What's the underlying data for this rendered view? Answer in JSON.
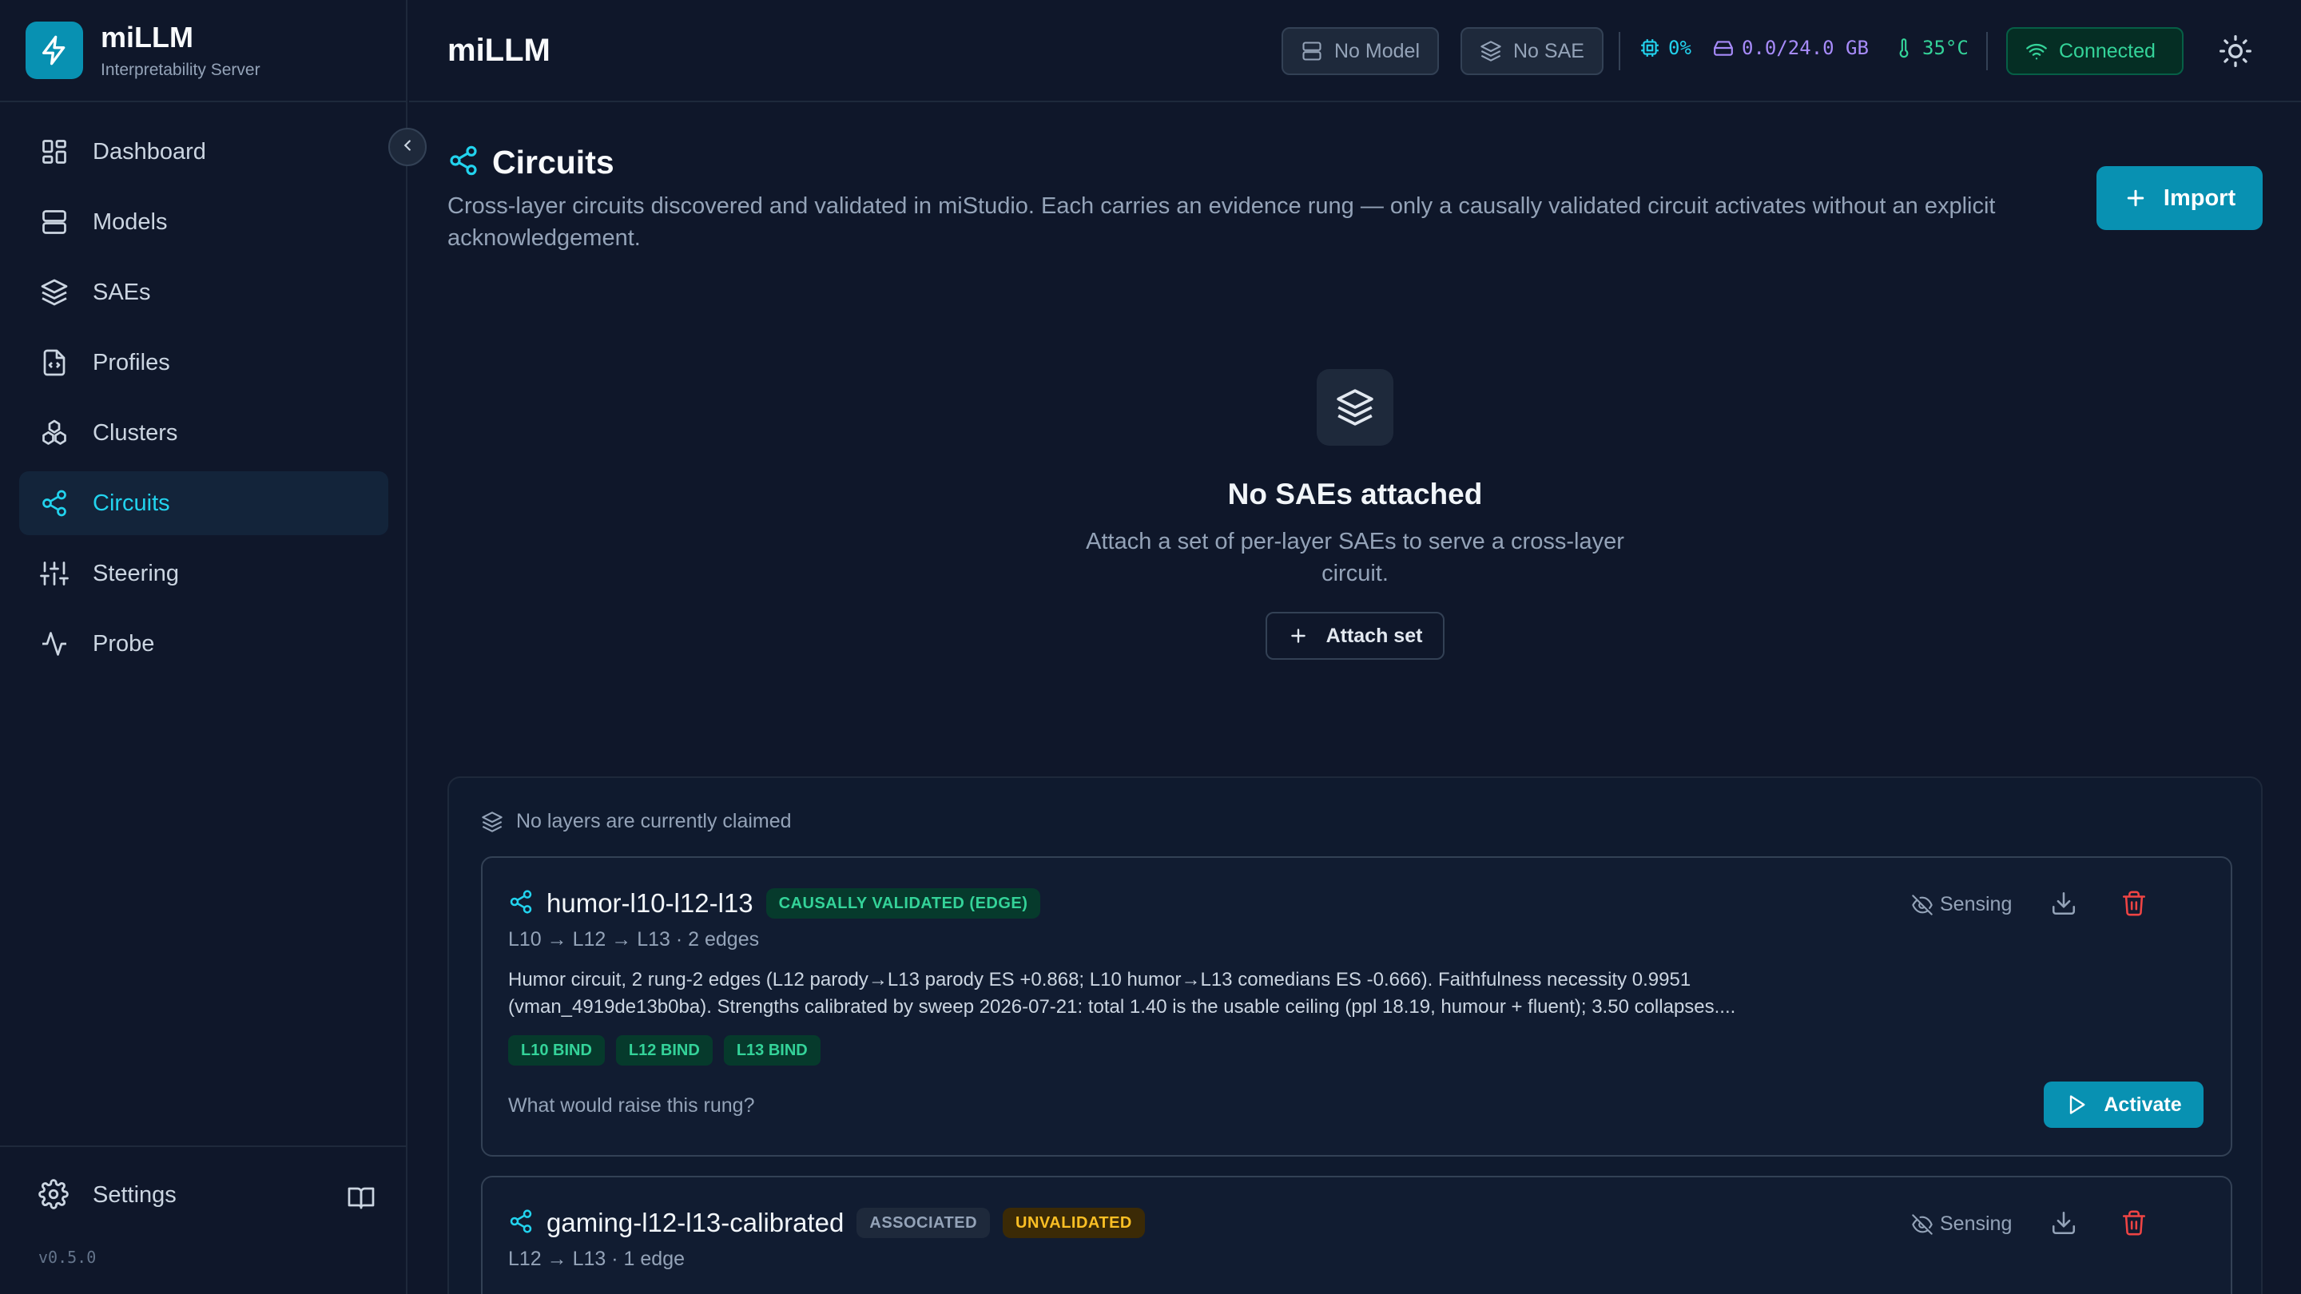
{
  "app": {
    "name": "miLLM",
    "subtitle": "Interpretability Server",
    "version": "v0.5.0"
  },
  "nav": {
    "items": [
      {
        "label": "Dashboard",
        "icon": "dashboard-icon"
      },
      {
        "label": "Models",
        "icon": "server-icon"
      },
      {
        "label": "SAEs",
        "icon": "layers-icon"
      },
      {
        "label": "Profiles",
        "icon": "file-code-icon"
      },
      {
        "label": "Clusters",
        "icon": "boxes-icon"
      },
      {
        "label": "Circuits",
        "icon": "share-icon",
        "active": true
      },
      {
        "label": "Steering",
        "icon": "sliders-icon"
      },
      {
        "label": "Probe",
        "icon": "activity-icon"
      }
    ],
    "settings_label": "Settings"
  },
  "header": {
    "title": "miLLM",
    "model_pill": "No Model",
    "sae_pill": "No SAE",
    "gpu_util": "0%",
    "memory": "0.0/24.0 GB",
    "temperature": "35°C",
    "connection": "Connected"
  },
  "page": {
    "title": "Circuits",
    "description": "Cross-layer circuits discovered and validated in miStudio. Each carries an evidence rung — only a causally validated circuit activates without an explicit acknowledgement.",
    "import_label": "Import"
  },
  "empty": {
    "title": "No SAEs attached",
    "description": "Attach a set of per-layer SAEs to serve a cross-layer circuit.",
    "button": "Attach set"
  },
  "panel": {
    "claimed_text": "No layers are currently claimed"
  },
  "circuits": [
    {
      "name": "humor-l10-l12-l13",
      "badges": [
        {
          "text": "CAUSALLY VALIDATED (EDGE)",
          "tone": "green"
        }
      ],
      "path": "L10 → L12 → L13 · 2 edges",
      "description": "Humor circuit, 2 rung-2 edges (L12 parody→L13 parody ES +0.868; L10 humor→L13 comedians ES -0.666). Faithfulness necessity 0.9951 (vman_4919de13b0ba). Strengths calibrated by sweep 2026-07-21: total 1.40 is the usable ceiling (ppl 18.19, humour + fluent); 3.50 collapses....",
      "tags": [
        "L10 BIND",
        "L12 BIND",
        "L13 BIND"
      ],
      "raise_text": "What would raise this rung?",
      "activate_label": "Activate",
      "sensing_label": "Sensing"
    },
    {
      "name": "gaming-l12-l13-calibrated",
      "badges": [
        {
          "text": "ASSOCIATED",
          "tone": "gray"
        },
        {
          "text": "UNVALIDATED",
          "tone": "amber"
        }
      ],
      "path": "L12 → L13 · 1 edge",
      "sensing_label": "Sensing"
    }
  ],
  "colors": {
    "accent": "#22d3ee",
    "primary_button": "#0891b2",
    "success": "#34d399",
    "warning": "#fbbf24",
    "danger": "#ef4444",
    "gpu_stat": "#22d3ee",
    "memory_stat": "#a78bfa",
    "temp_stat": "#34d399"
  }
}
